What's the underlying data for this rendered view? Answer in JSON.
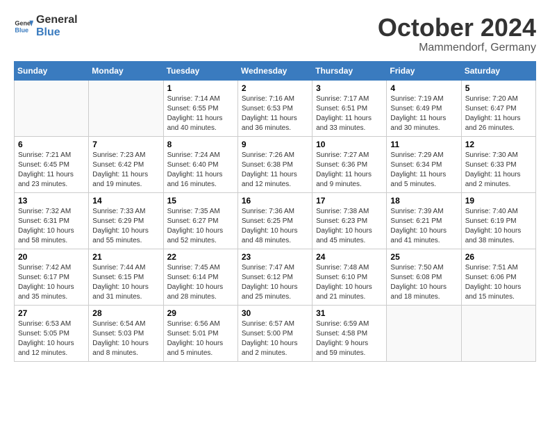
{
  "header": {
    "logo_line1": "General",
    "logo_line2": "Blue",
    "month": "October 2024",
    "location": "Mammendorf, Germany"
  },
  "weekdays": [
    "Sunday",
    "Monday",
    "Tuesday",
    "Wednesday",
    "Thursday",
    "Friday",
    "Saturday"
  ],
  "weeks": [
    [
      {
        "day": "",
        "info": ""
      },
      {
        "day": "",
        "info": ""
      },
      {
        "day": "1",
        "info": "Sunrise: 7:14 AM\nSunset: 6:55 PM\nDaylight: 11 hours\nand 40 minutes."
      },
      {
        "day": "2",
        "info": "Sunrise: 7:16 AM\nSunset: 6:53 PM\nDaylight: 11 hours\nand 36 minutes."
      },
      {
        "day": "3",
        "info": "Sunrise: 7:17 AM\nSunset: 6:51 PM\nDaylight: 11 hours\nand 33 minutes."
      },
      {
        "day": "4",
        "info": "Sunrise: 7:19 AM\nSunset: 6:49 PM\nDaylight: 11 hours\nand 30 minutes."
      },
      {
        "day": "5",
        "info": "Sunrise: 7:20 AM\nSunset: 6:47 PM\nDaylight: 11 hours\nand 26 minutes."
      }
    ],
    [
      {
        "day": "6",
        "info": "Sunrise: 7:21 AM\nSunset: 6:45 PM\nDaylight: 11 hours\nand 23 minutes."
      },
      {
        "day": "7",
        "info": "Sunrise: 7:23 AM\nSunset: 6:42 PM\nDaylight: 11 hours\nand 19 minutes."
      },
      {
        "day": "8",
        "info": "Sunrise: 7:24 AM\nSunset: 6:40 PM\nDaylight: 11 hours\nand 16 minutes."
      },
      {
        "day": "9",
        "info": "Sunrise: 7:26 AM\nSunset: 6:38 PM\nDaylight: 11 hours\nand 12 minutes."
      },
      {
        "day": "10",
        "info": "Sunrise: 7:27 AM\nSunset: 6:36 PM\nDaylight: 11 hours\nand 9 minutes."
      },
      {
        "day": "11",
        "info": "Sunrise: 7:29 AM\nSunset: 6:34 PM\nDaylight: 11 hours\nand 5 minutes."
      },
      {
        "day": "12",
        "info": "Sunrise: 7:30 AM\nSunset: 6:33 PM\nDaylight: 11 hours\nand 2 minutes."
      }
    ],
    [
      {
        "day": "13",
        "info": "Sunrise: 7:32 AM\nSunset: 6:31 PM\nDaylight: 10 hours\nand 58 minutes."
      },
      {
        "day": "14",
        "info": "Sunrise: 7:33 AM\nSunset: 6:29 PM\nDaylight: 10 hours\nand 55 minutes."
      },
      {
        "day": "15",
        "info": "Sunrise: 7:35 AM\nSunset: 6:27 PM\nDaylight: 10 hours\nand 52 minutes."
      },
      {
        "day": "16",
        "info": "Sunrise: 7:36 AM\nSunset: 6:25 PM\nDaylight: 10 hours\nand 48 minutes."
      },
      {
        "day": "17",
        "info": "Sunrise: 7:38 AM\nSunset: 6:23 PM\nDaylight: 10 hours\nand 45 minutes."
      },
      {
        "day": "18",
        "info": "Sunrise: 7:39 AM\nSunset: 6:21 PM\nDaylight: 10 hours\nand 41 minutes."
      },
      {
        "day": "19",
        "info": "Sunrise: 7:40 AM\nSunset: 6:19 PM\nDaylight: 10 hours\nand 38 minutes."
      }
    ],
    [
      {
        "day": "20",
        "info": "Sunrise: 7:42 AM\nSunset: 6:17 PM\nDaylight: 10 hours\nand 35 minutes."
      },
      {
        "day": "21",
        "info": "Sunrise: 7:44 AM\nSunset: 6:15 PM\nDaylight: 10 hours\nand 31 minutes."
      },
      {
        "day": "22",
        "info": "Sunrise: 7:45 AM\nSunset: 6:14 PM\nDaylight: 10 hours\nand 28 minutes."
      },
      {
        "day": "23",
        "info": "Sunrise: 7:47 AM\nSunset: 6:12 PM\nDaylight: 10 hours\nand 25 minutes."
      },
      {
        "day": "24",
        "info": "Sunrise: 7:48 AM\nSunset: 6:10 PM\nDaylight: 10 hours\nand 21 minutes."
      },
      {
        "day": "25",
        "info": "Sunrise: 7:50 AM\nSunset: 6:08 PM\nDaylight: 10 hours\nand 18 minutes."
      },
      {
        "day": "26",
        "info": "Sunrise: 7:51 AM\nSunset: 6:06 PM\nDaylight: 10 hours\nand 15 minutes."
      }
    ],
    [
      {
        "day": "27",
        "info": "Sunrise: 6:53 AM\nSunset: 5:05 PM\nDaylight: 10 hours\nand 12 minutes."
      },
      {
        "day": "28",
        "info": "Sunrise: 6:54 AM\nSunset: 5:03 PM\nDaylight: 10 hours\nand 8 minutes."
      },
      {
        "day": "29",
        "info": "Sunrise: 6:56 AM\nSunset: 5:01 PM\nDaylight: 10 hours\nand 5 minutes."
      },
      {
        "day": "30",
        "info": "Sunrise: 6:57 AM\nSunset: 5:00 PM\nDaylight: 10 hours\nand 2 minutes."
      },
      {
        "day": "31",
        "info": "Sunrise: 6:59 AM\nSunset: 4:58 PM\nDaylight: 9 hours\nand 59 minutes."
      },
      {
        "day": "",
        "info": ""
      },
      {
        "day": "",
        "info": ""
      }
    ]
  ]
}
